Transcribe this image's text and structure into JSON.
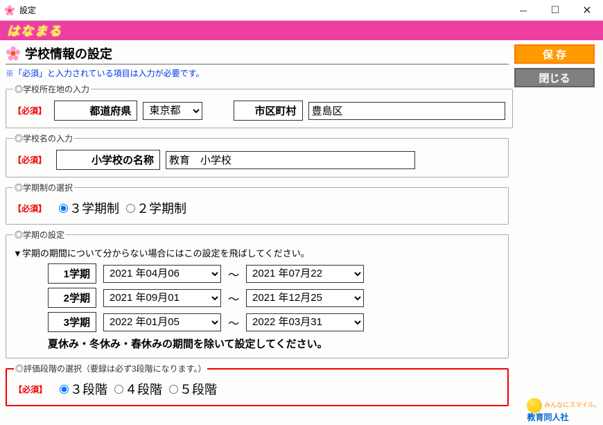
{
  "window": {
    "title": "設定"
  },
  "brand": "はなまる",
  "page": {
    "title": "学校情報の設定"
  },
  "note": "※「必須」と入力されている項目は入力が必要です。",
  "required_mark": "【必須】",
  "buttons": {
    "save": "保 存",
    "close": "閉じる"
  },
  "loc": {
    "legend": "◎学校所在地の入力",
    "pref_label": "都道府県",
    "pref_value": "東京都",
    "city_label": "市区町村",
    "city_value": "豊島区"
  },
  "school": {
    "legend": "◎学校名の入力",
    "name_label": "小学校の名称",
    "name_value": "教育　小学校"
  },
  "termsys": {
    "legend": "◎学期制の選択",
    "opt3": "３学期制",
    "opt2": "２学期制",
    "selected": "3"
  },
  "terms": {
    "legend": "◎学期の設定",
    "help": "▼学期の期間について分からない場合にはこの設定を飛ばしてください。",
    "sep": "～",
    "rows": [
      {
        "label": "1学期",
        "start": "2021 年04月06",
        "end": "2021 年07月22"
      },
      {
        "label": "2学期",
        "start": "2021 年09月01",
        "end": "2021 年12月25"
      },
      {
        "label": "3学期",
        "start": "2022 年01月05",
        "end": "2022 年03月31"
      }
    ],
    "footnote": "夏休み・冬休み・春休みの期間を除いて設定してください。"
  },
  "eval": {
    "legend": "◎評価段階の選択（要録は必ず3段階になります。）",
    "opt3": "３段階",
    "opt4": "４段階",
    "opt5": "５段階",
    "selected": "3"
  },
  "footer": {
    "line1": "みんなにスマイル。",
    "line2": "教育同人社"
  }
}
